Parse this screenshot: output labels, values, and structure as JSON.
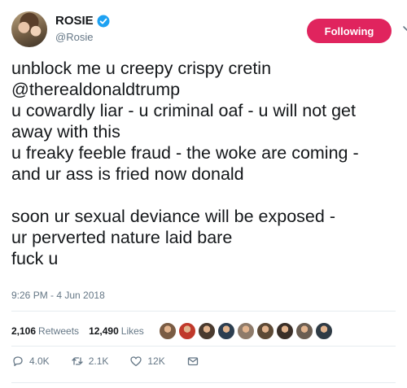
{
  "author": {
    "display_name": "ROSIE",
    "handle": "@Rosie",
    "avatar_icon": "user-avatar"
  },
  "follow_button_label": "Following",
  "tweet_text": "unblock me u creepy crispy cretin\n@therealdonaldtrump\nu cowardly liar - u criminal oaf - u will not get\naway with this\nu freaky feeble fraud - the woke are coming -\nand ur ass is fried now donald\n\nsoon ur sexual deviance will be exposed -\nur perverted nature laid bare\nfuck u",
  "timestamp": "9:26 PM - 4 Jun 2018",
  "stats": {
    "retweets_count": "2,106",
    "retweets_label": "Retweets",
    "likes_count": "12,490",
    "likes_label": "Likes"
  },
  "likers_colors": [
    "#7a5c44",
    "#c0392b",
    "#4a3b2f",
    "#2c3e50",
    "#8e7b6a",
    "#5d4a36",
    "#3a2f28",
    "#6b5e52",
    "#2f3b45"
  ],
  "actions": {
    "replies": "4.0K",
    "retweets": "2.1K",
    "likes": "12K"
  },
  "colors": {
    "accent": "#e0245e",
    "verified": "#1da1f2",
    "secondary_text": "#657786"
  }
}
